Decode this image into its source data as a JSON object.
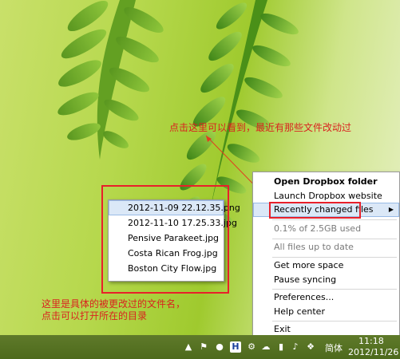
{
  "annotations": {
    "top": "点击这里可以看到，最近有那些文件改动过",
    "bottom_line1": "这里是具体的被更改过的文件名，",
    "bottom_line2": "点击可以打开所在的目录",
    "color": "#d9231f"
  },
  "recent_files": [
    "2012-11-09 22.12.35.png",
    "2012-11-10 17.25.33.jpg",
    "Pensive Parakeet.jpg",
    "Costa Rican Frog.jpg",
    "Boston City Flow.jpg"
  ],
  "menu": {
    "open_folder": "Open Dropbox folder",
    "launch_website": "Launch Dropbox website",
    "recently_changed": "Recently changed files",
    "usage": "0.1% of 2.5GB used",
    "status": "All files up to date",
    "get_more_space": "Get more space",
    "pause_syncing": "Pause syncing",
    "preferences": "Preferences...",
    "help_center": "Help center",
    "exit": "Exit"
  },
  "taskbar": {
    "ime": "简体",
    "time": "11:18",
    "date": "2012/11/26",
    "icons": [
      "show-hidden-icon",
      "flag-icon",
      "qq-icon",
      "h-icon",
      "gear-icon",
      "cloud-icon",
      "network-icon",
      "volume-icon",
      "dropbox-icon"
    ]
  }
}
